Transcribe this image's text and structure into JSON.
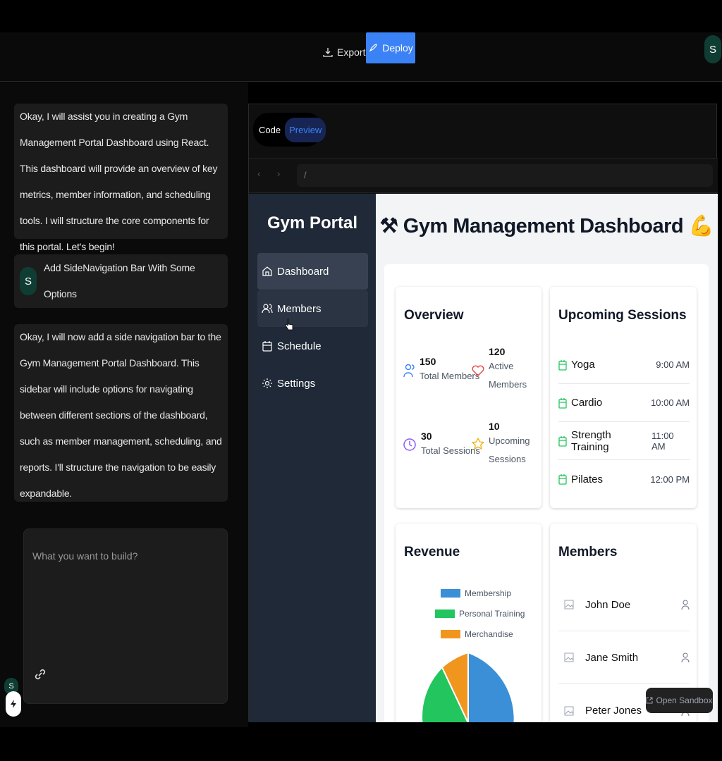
{
  "topbar": {
    "export_label": "Export",
    "deploy_label": "Deploy",
    "user_initial": "S"
  },
  "chat": {
    "messages": [
      {
        "role": "assistant",
        "text": "Okay, I will assist you in creating a Gym Management Portal Dashboard using React. This dashboard will provide an overview of key metrics, member information, and scheduling tools. I will structure the core components for this portal. Let's begin!"
      },
      {
        "role": "user",
        "initial": "S",
        "text": "Add SideNavigation Bar With Some Options"
      },
      {
        "role": "assistant",
        "text": "Okay, I will now add a side navigation bar to the Gym Management Portal Dashboard. This sidebar will include options for navigating between different sections of the dashboard, such as member management, scheduling, and reports. I'll structure the navigation to be easily expandable."
      }
    ],
    "composer_placeholder": "What you want to build?",
    "bolt_initial": "S"
  },
  "preview": {
    "tabs": {
      "code": "Code",
      "preview": "Preview",
      "active": "Preview"
    },
    "url": "/",
    "open_sandbox": "Open Sandbox"
  },
  "app": {
    "sidebar": {
      "title": "Gym Portal",
      "items": [
        {
          "label": "Dashboard",
          "icon": "home-icon"
        },
        {
          "label": "Members",
          "icon": "users-icon"
        },
        {
          "label": "Schedule",
          "icon": "calendar-icon"
        },
        {
          "label": "Settings",
          "icon": "gear-icon"
        }
      ]
    },
    "title": "Gym Management Dashboard",
    "title_prefix_icon": "dumbbell-icon",
    "title_suffix_icon": "flexed-biceps-icon",
    "overview": {
      "title": "Overview",
      "stats": [
        {
          "value": "150",
          "label": "Total Members",
          "icon": "users-icon",
          "color": "#3b82f6"
        },
        {
          "value": "120",
          "label": "Active Members",
          "icon": "heart-icon",
          "color": "#ef4444"
        },
        {
          "value": "30",
          "label": "Total Sessions",
          "icon": "clock-icon",
          "color": "#8b5cf6"
        },
        {
          "value": "10",
          "label": "Upcoming Sessions",
          "icon": "star-icon",
          "color": "#eab308"
        }
      ]
    },
    "sessions": {
      "title": "Upcoming Sessions",
      "items": [
        {
          "name": "Yoga",
          "time": "9:00 AM"
        },
        {
          "name": "Cardio",
          "time": "10:00 AM"
        },
        {
          "name": "Strength Training",
          "time": "11:00 AM"
        },
        {
          "name": "Pilates",
          "time": "12:00 PM"
        }
      ]
    },
    "revenue": {
      "title": "Revenue",
      "legend": [
        {
          "label": "Membership",
          "color": "#3b8fd6"
        },
        {
          "label": "Personal Training",
          "color": "#22c55e"
        },
        {
          "label": "Merchandise",
          "color": "#f0961f"
        }
      ]
    },
    "members": {
      "title": "Members",
      "items": [
        "John Doe",
        "Jane Smith",
        "Peter Jones"
      ]
    }
  }
}
